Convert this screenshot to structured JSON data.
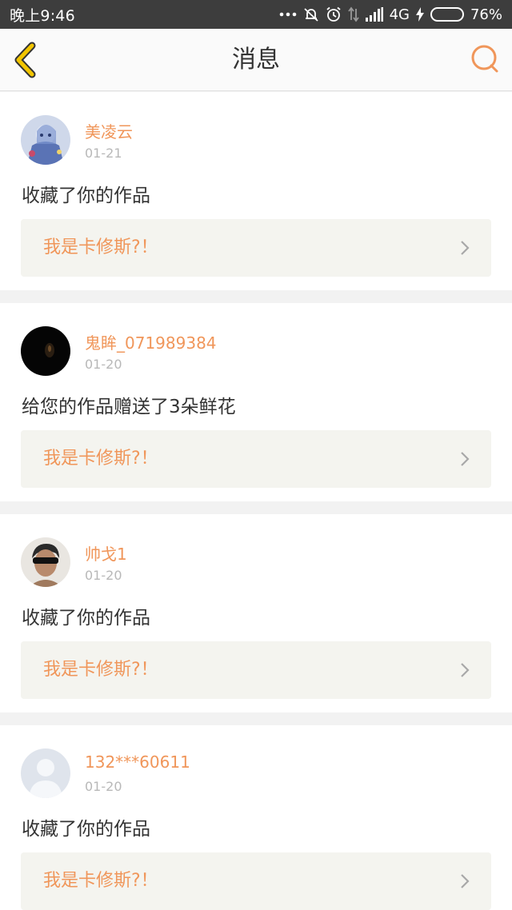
{
  "status_bar": {
    "time": "晚上9:46",
    "network": "4G",
    "battery": "76%",
    "battery_level": 0.76
  },
  "header": {
    "title": "消息",
    "back_icon": "chevron-left-icon",
    "search_icon": "search-icon"
  },
  "colors": {
    "accent": "#f0965a",
    "back_arrow": "#f2c500",
    "card_box": "#f4f4ef"
  },
  "messages": [
    {
      "username": "美凌云",
      "date": "01-21",
      "text": "收藏了你的作品",
      "work_title": "我是卡修斯?！"
    },
    {
      "username": "鬼眸_071989384",
      "date": "01-20",
      "text": "给您的作品赠送了3朵鲜花",
      "work_title": "我是卡修斯?！"
    },
    {
      "username": "帅戈1",
      "date": "01-20",
      "text": "收藏了你的作品",
      "work_title": "我是卡修斯?！"
    },
    {
      "username": "132***60611",
      "date": "01-20",
      "text": "收藏了你的作品",
      "work_title": "我是卡修斯?！"
    }
  ]
}
